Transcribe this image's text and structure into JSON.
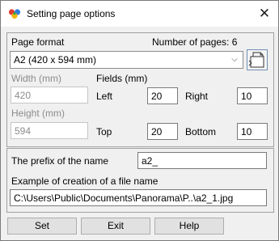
{
  "window": {
    "title": "Setting page options",
    "icon": "app-logo-icon",
    "close_glyph": "✕"
  },
  "page_format": {
    "label": "Page format",
    "pages_label": "Number of pages: 6",
    "selected": "A2 (420 x 594 mm)",
    "page_setup_icon": "page-orientation-icon"
  },
  "size": {
    "width_label": "Width (mm)",
    "width_value": "420",
    "height_label": "Height (mm)",
    "height_value": "594"
  },
  "fields": {
    "label": "Fields (mm)",
    "left_label": "Left",
    "left_value": "20",
    "right_label": "Right",
    "right_value": "10",
    "top_label": "Top",
    "top_value": "20",
    "bottom_label": "Bottom",
    "bottom_value": "10"
  },
  "naming": {
    "prefix_label": "The prefix of the name",
    "prefix_value": "a2_",
    "example_label": "Example of creation of a file name",
    "example_value": "C:\\Users\\Public\\Documents\\Panorama\\P..\\a2_1.jpg"
  },
  "buttons": {
    "set": "Set",
    "exit": "Exit",
    "help": "Help"
  }
}
